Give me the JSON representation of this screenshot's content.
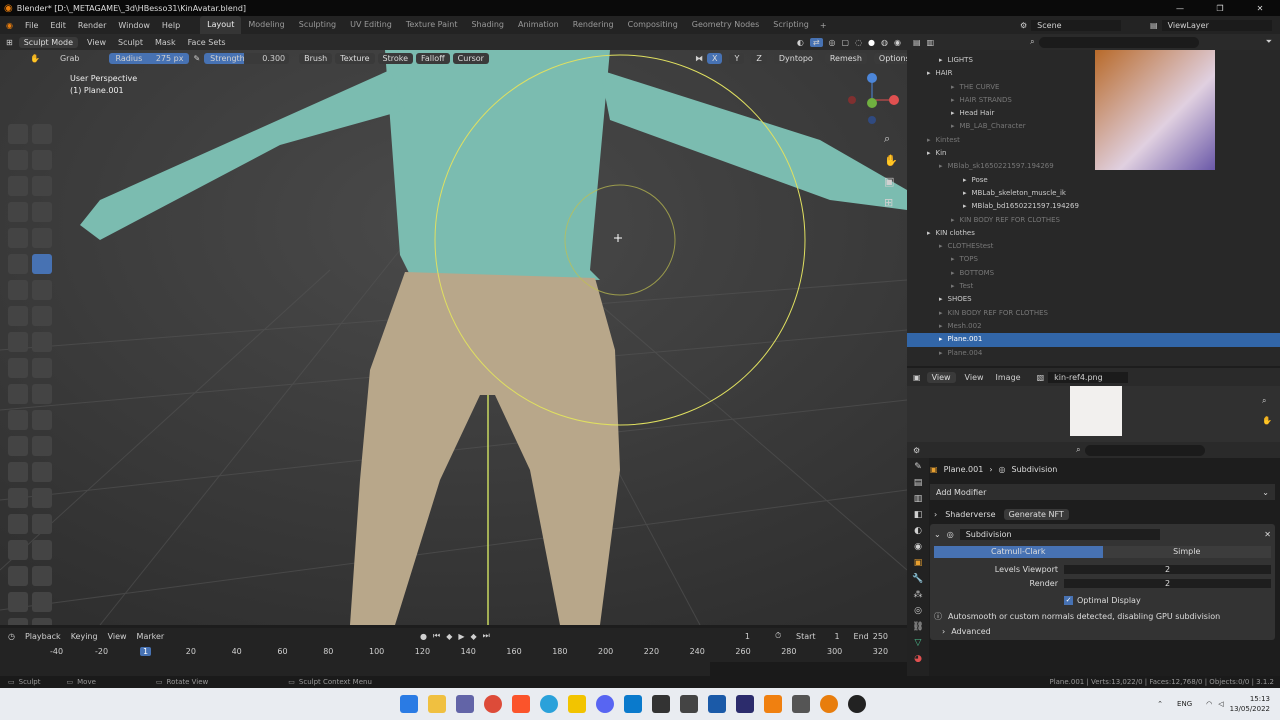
{
  "titlebar": {
    "title": "Blender* [D:\\_METAGAME\\_3d\\HBesso31\\KinAvatar.blend]",
    "controls": [
      "—",
      "❐",
      "✕"
    ]
  },
  "menus": [
    "File",
    "Edit",
    "Render",
    "Window",
    "Help"
  ],
  "workspaces": [
    "Layout",
    "Modeling",
    "Sculpting",
    "UV Editing",
    "Texture Paint",
    "Shading",
    "Animation",
    "Rendering",
    "Compositing",
    "Geometry Nodes",
    "Scripting"
  ],
  "active_workspace": "Layout",
  "scene": "Scene",
  "view_layer": "ViewLayer",
  "sculpt_header": {
    "mode": "Sculpt Mode",
    "menus": [
      "View",
      "Sculpt",
      "Mask",
      "Face Sets"
    ]
  },
  "brush_header": {
    "brush": "Grab",
    "radius_label": "Radius",
    "radius": "275 px",
    "strength_label": "Strength",
    "strength": "0.300",
    "dropdowns": [
      "Brush",
      "Texture",
      "Stroke",
      "Falloff",
      "Cursor"
    ],
    "axes": [
      "X",
      "Y",
      "Z"
    ],
    "dyntopo": "Dyntopo",
    "remesh": "Remesh",
    "options": "Options"
  },
  "viewport": {
    "perspective": "User Perspective",
    "object": "(1) Plane.001"
  },
  "outliner": [
    {
      "name": "LIGHTS",
      "indent": 2,
      "dim": false
    },
    {
      "name": "HAIR",
      "indent": 1,
      "dim": false
    },
    {
      "name": "THE CURVE",
      "indent": 3,
      "dim": true
    },
    {
      "name": "HAIR STRANDS",
      "indent": 3,
      "dim": true
    },
    {
      "name": "Head Hair",
      "indent": 3,
      "dim": false
    },
    {
      "name": "MB_LAB_Character",
      "indent": 3,
      "dim": true
    },
    {
      "name": "Kintest",
      "indent": 1,
      "dim": true
    },
    {
      "name": "Kin",
      "indent": 1,
      "dim": false
    },
    {
      "name": "MBlab_sk1650221597.194269",
      "indent": 2,
      "dim": true
    },
    {
      "name": "Pose",
      "indent": 4,
      "dim": false
    },
    {
      "name": "MBLab_skeleton_muscle_ik",
      "indent": 4,
      "dim": false
    },
    {
      "name": "MBlab_bd1650221597.194269",
      "indent": 4,
      "dim": false
    },
    {
      "name": "KIN BODY REF FOR CLOTHES",
      "indent": 3,
      "dim": true
    },
    {
      "name": "KIN clothes",
      "indent": 1,
      "dim": false
    },
    {
      "name": "CLOTHEStest",
      "indent": 2,
      "dim": true
    },
    {
      "name": "TOPS",
      "indent": 3,
      "dim": true
    },
    {
      "name": "BOTTOMS",
      "indent": 3,
      "dim": true
    },
    {
      "name": "Test",
      "indent": 3,
      "dim": true
    },
    {
      "name": "SHOES",
      "indent": 2,
      "dim": false
    },
    {
      "name": "KIN BODY REF FOR CLOTHES",
      "indent": 2,
      "dim": true
    },
    {
      "name": "Mesh.002",
      "indent": 2,
      "dim": true
    },
    {
      "name": "Plane.001",
      "indent": 2,
      "dim": false,
      "selected": true
    },
    {
      "name": "Plane.004",
      "indent": 2,
      "dim": true
    }
  ],
  "image_editor": {
    "menus": [
      "View",
      "View",
      "Image"
    ],
    "image": "kin-ref4.png"
  },
  "properties": {
    "breadcrumb_obj": "Plane.001",
    "breadcrumb_mod": "Subdivision",
    "add_modifier": "Add Modifier",
    "shaderverse": "Shaderverse",
    "generate_nft": "Generate NFT",
    "modifier_name": "Subdivision",
    "type_a": "Catmull-Clark",
    "type_b": "Simple",
    "levels_label": "Levels Viewport",
    "levels": "2",
    "render_label": "Render",
    "render": "2",
    "optimal": "Optimal Display",
    "warning": "Autosmooth or custom normals detected, disabling GPU subdivision",
    "advanced": "Advanced"
  },
  "timeline": {
    "menus": [
      "Playback",
      "Keying",
      "View",
      "Marker"
    ],
    "frame": "1",
    "start_label": "Start",
    "start": "1",
    "end_label": "End",
    "end": "250",
    "ticks": [
      "-40",
      "-20",
      "1",
      "20",
      "40",
      "60",
      "80",
      "100",
      "120",
      "140",
      "160",
      "180",
      "200",
      "220",
      "240",
      "260",
      "280",
      "300",
      "320"
    ]
  },
  "statusbar": {
    "left": [
      "Sculpt",
      "Move",
      "Rotate View",
      "Sculpt Context Menu"
    ],
    "right": "Plane.001 | Verts:13,022/0 | Faces:12,768/0 | Objects:0/0 | 3.1.2"
  },
  "taskbar": {
    "lang": "ENG",
    "time": "15:13",
    "date": "13/05/2022"
  },
  "colors": {
    "accent": "#4772b3",
    "select": "#3266a8",
    "brush_circle": "#e0e060",
    "shirt": "#7bbcb0",
    "pants": "#b8a78a"
  }
}
